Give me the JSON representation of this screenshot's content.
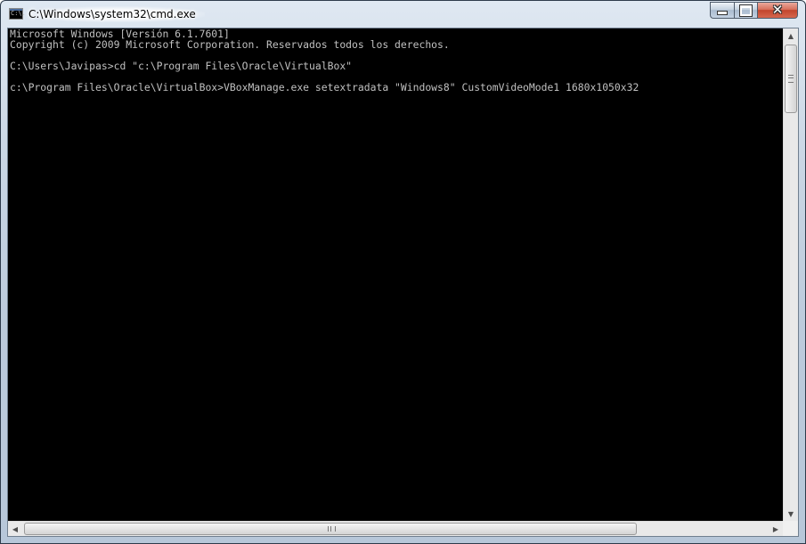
{
  "window": {
    "title": "C:\\Windows\\system32\\cmd.exe",
    "icon": "cmd-icon",
    "icon_label": "C:\\.",
    "controls": {
      "minimize_icon": "minimize-icon",
      "maximize_icon": "maximize-icon",
      "close_icon": "close-icon",
      "close_glyph": "✕",
      "close_color": "#c74a31"
    }
  },
  "console": {
    "background": "#000000",
    "foreground": "#c0c0c0",
    "lines": [
      "Microsoft Windows [Versión 6.1.7601]",
      "Copyright (c) 2009 Microsoft Corporation. Reservados todos los derechos.",
      "",
      "C:\\Users\\Javipas>cd \"c:\\Program Files\\Oracle\\VirtualBox\"",
      "",
      "c:\\Program Files\\Oracle\\VirtualBox>VBoxManage.exe setextradata \"Windows8\" CustomVideoMode1 1680x1050x32"
    ]
  },
  "scrollbars": {
    "up_arrow": "▲",
    "down_arrow": "▼",
    "left_arrow": "◀",
    "right_arrow": "▶"
  }
}
